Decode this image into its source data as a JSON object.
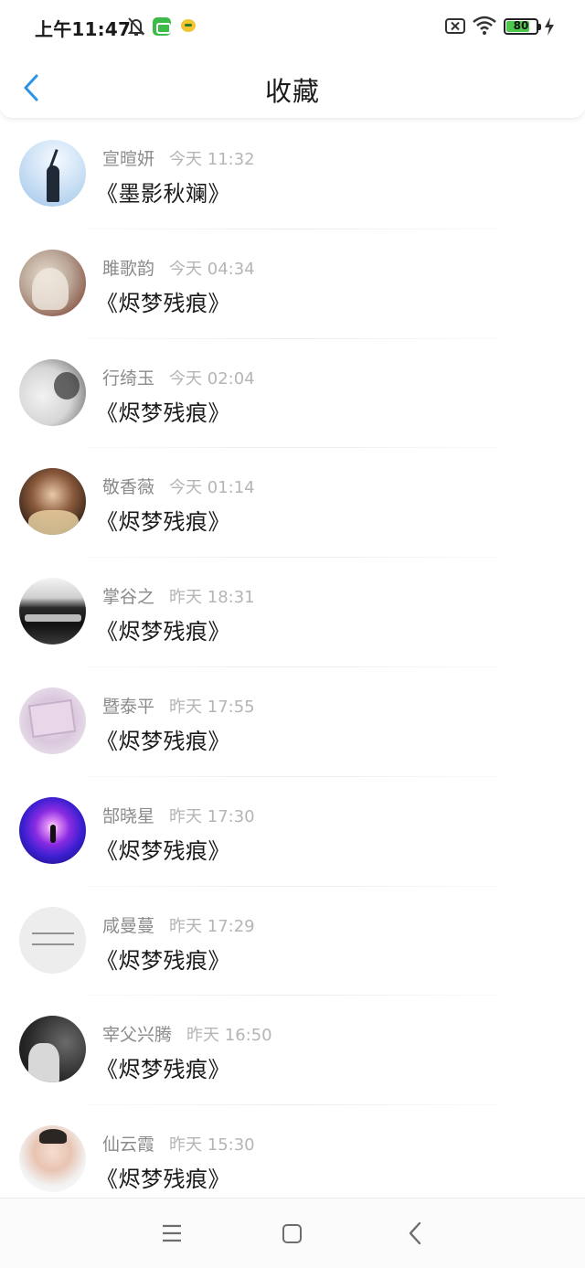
{
  "status_bar": {
    "time": "上午11:47",
    "battery_level": 80,
    "battery_label": "80",
    "icons": [
      "bell-off-icon",
      "app-notification-icon",
      "app-notification-icon",
      "sim-x-icon",
      "wifi-icon",
      "battery-icon",
      "charging-icon"
    ]
  },
  "header": {
    "title": "收藏",
    "back_icon": "chevron-left-icon",
    "accent_color": "#2a93e6"
  },
  "favorites": [
    {
      "author": "宣暄妍",
      "time": "今天 11:32",
      "title": "《墨影秋斓》"
    },
    {
      "author": "雎歌韵",
      "time": "今天 04:34",
      "title": "《烬梦残痕》"
    },
    {
      "author": "行绮玉",
      "time": "今天 02:04",
      "title": "《烬梦残痕》"
    },
    {
      "author": "敬香薇",
      "time": "今天 01:14",
      "title": "《烬梦残痕》"
    },
    {
      "author": "掌谷之",
      "time": "昨天 18:31",
      "title": "《烬梦残痕》"
    },
    {
      "author": "暨泰平",
      "time": "昨天 17:55",
      "title": "《烬梦残痕》"
    },
    {
      "author": "郜晓星",
      "time": "昨天 17:30",
      "title": "《烬梦残痕》"
    },
    {
      "author": "咸曼蔓",
      "time": "昨天 17:29",
      "title": "《烬梦残痕》"
    },
    {
      "author": "宰父兴腾",
      "time": "昨天 16:50",
      "title": "《烬梦残痕》"
    },
    {
      "author": "仙云霞",
      "time": "昨天 15:30",
      "title": "《烬梦残痕》"
    }
  ],
  "nav_bar": {
    "icons": [
      "menu-icon",
      "home-icon",
      "back-icon"
    ]
  }
}
